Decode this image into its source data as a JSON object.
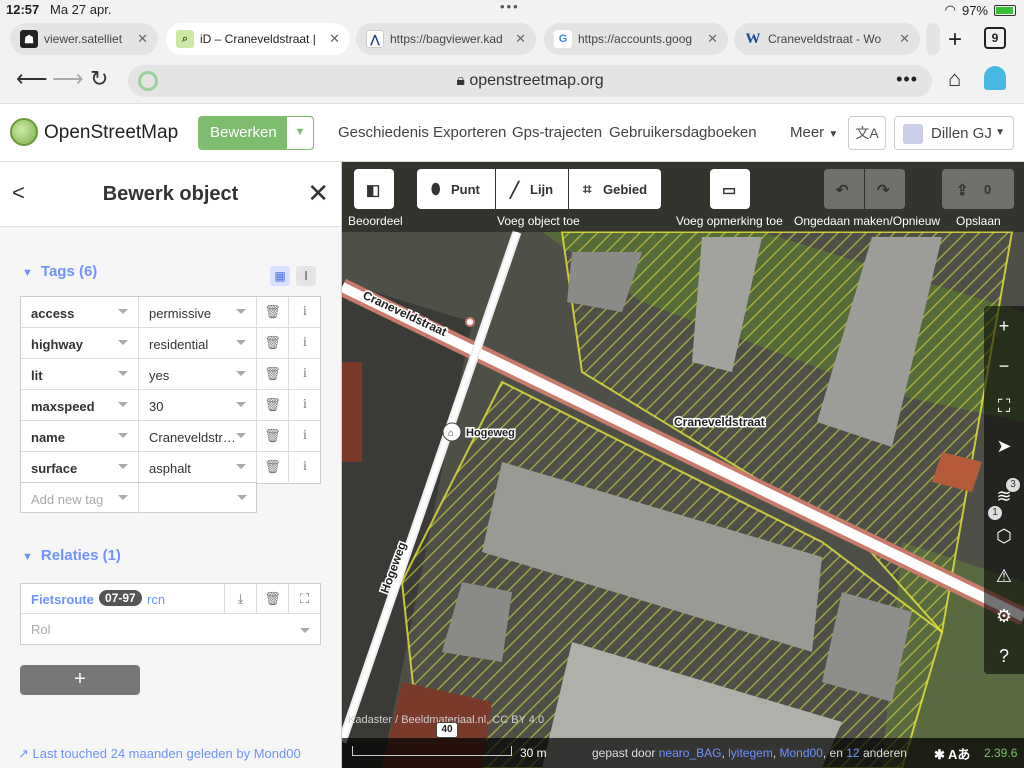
{
  "status": {
    "time": "12:57",
    "date": "Ma 27 apr.",
    "battery": "97%"
  },
  "browser": {
    "tabs": [
      {
        "title": "viewer.satelliet",
        "icon": "satellite-icon"
      },
      {
        "title": "iD – Craneveldstraat |",
        "icon": "osm-icon",
        "active": true
      },
      {
        "title": "https://bagviewer.kad",
        "icon": "kadaster-icon"
      },
      {
        "title": "https://accounts.goog",
        "icon": "google-icon"
      },
      {
        "title": "Craneveldstraat - Wo",
        "icon": "wikipedia-icon"
      }
    ],
    "tab_count": "9",
    "url": "openstreetmap.org"
  },
  "osm": {
    "brand": "OpenStreetMap",
    "edit_label": "Bewerken",
    "nav": [
      "Geschiedenis",
      "Exporteren",
      "Gps-trajecten",
      "Gebruikersdagboeken"
    ],
    "more_label": "Meer",
    "user": "Dillen GJ"
  },
  "sidebar": {
    "title": "Bewerk object",
    "tags_header": "Tags (6)",
    "tags": [
      {
        "key": "access",
        "value": "permissive"
      },
      {
        "key": "highway",
        "value": "residential"
      },
      {
        "key": "lit",
        "value": "yes"
      },
      {
        "key": "maxspeed",
        "value": "30"
      },
      {
        "key": "name",
        "value": "Craneveldstr…"
      },
      {
        "key": "surface",
        "value": "asphalt"
      }
    ],
    "new_tag_placeholder": "Add new tag",
    "relations_header": "Relaties (1)",
    "relation": {
      "name": "Fietsroute",
      "ref": "07-97",
      "network": "rcn",
      "role_placeholder": "Rol"
    },
    "add_relation": "+",
    "last_touched": "Last touched 24 maanden geleden by Mond00"
  },
  "toolbar": {
    "beoordeel": "Beoordeel",
    "punt": "Punt",
    "lijn": "Lijn",
    "gebied": "Gebied",
    "add_label": "Voeg object toe",
    "note_label": "Voeg opmerking toe",
    "undo_label": "Ongedaan maken/Opnieuw",
    "save_label": "Opslaan",
    "save_count": "0"
  },
  "map": {
    "street_main": "Craneveldstraat",
    "street_main_2": "Craneveldstraat",
    "street_side": "Hogeweg",
    "poi_label": "Hogeweg",
    "shield": "40",
    "attribution": "Kadaster / Beeldmateriaal.nl, CC BY 4.0",
    "scale": "30 m",
    "contrib_prefix": "gepast door",
    "contributors": [
      "nearo_BAG",
      "lyitegem",
      "Mond00"
    ],
    "contrib_suffix_a": "en",
    "contrib_count": "12",
    "contrib_suffix_b": "anderen",
    "version": "2.39.6",
    "layer_badges": [
      "3",
      "1"
    ]
  }
}
